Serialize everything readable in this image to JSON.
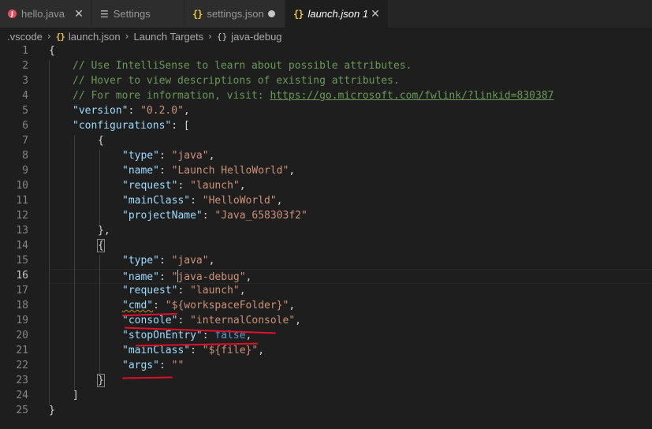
{
  "tabs": [
    {
      "label": "hello.java",
      "icon": "java-icon",
      "state": "close"
    },
    {
      "label": "Settings",
      "icon": "settings-icon",
      "state": "none"
    },
    {
      "label": "settings.json",
      "icon": "json-icon",
      "state": "modified"
    },
    {
      "label": "launch.json",
      "badge": "1",
      "icon": "json-icon",
      "state": "close",
      "active": true
    }
  ],
  "breadcrumb": {
    "folder": ".vscode",
    "file": "launch.json",
    "section": "Launch Targets",
    "item": "java-debug"
  },
  "gutter": [
    "1",
    "2",
    "3",
    "4",
    "5",
    "6",
    "7",
    "8",
    "9",
    "10",
    "11",
    "12",
    "13",
    "14",
    "15",
    "16",
    "17",
    "18",
    "19",
    "20",
    "21",
    "22",
    "23",
    "24",
    "25"
  ],
  "current_line": "16",
  "code": {
    "l1": "{",
    "l2": "// Use IntelliSense to learn about possible attributes.",
    "l3": "// Hover to view descriptions of existing attributes.",
    "l4_prefix": "// For more information, visit: ",
    "l4_link": "https://go.microsoft.com/fwlink/?linkid=830387",
    "version_key": "\"version\"",
    "version_val": "\"0.2.0\"",
    "configurations_key": "\"configurations\"",
    "type_key": "\"type\"",
    "type_val": "\"java\"",
    "name_key": "\"name\"",
    "name_val_1": "\"Launch HelloWorld\"",
    "name_val_2a": "\"",
    "name_val_2b": "java-debug\"",
    "request_key": "\"request\"",
    "request_val": "\"launch\"",
    "mainClass_key": "\"mainClass\"",
    "mainClass_val_1": "\"HelloWorld\"",
    "mainClass_val_2": "\"${file}\"",
    "projectName_key": "\"projectName\"",
    "projectName_val": "\"Java_658303f2\"",
    "cmd_key": "\"cmd\"",
    "cmd_val": "\"${workspaceFolder}\"",
    "console_key": "\"console\"",
    "console_val": "\"internalConsole\"",
    "stopOnEntry_key": "\"stopOnEntry\"",
    "stopOnEntry_val": "false",
    "args_key": "\"args\"",
    "args_val": "\"\""
  },
  "colors": {
    "comment": "#6a9955",
    "key": "#9cdcfe",
    "string": "#ce9178",
    "keyword": "#569cd6",
    "annotation": "#e0102a"
  }
}
